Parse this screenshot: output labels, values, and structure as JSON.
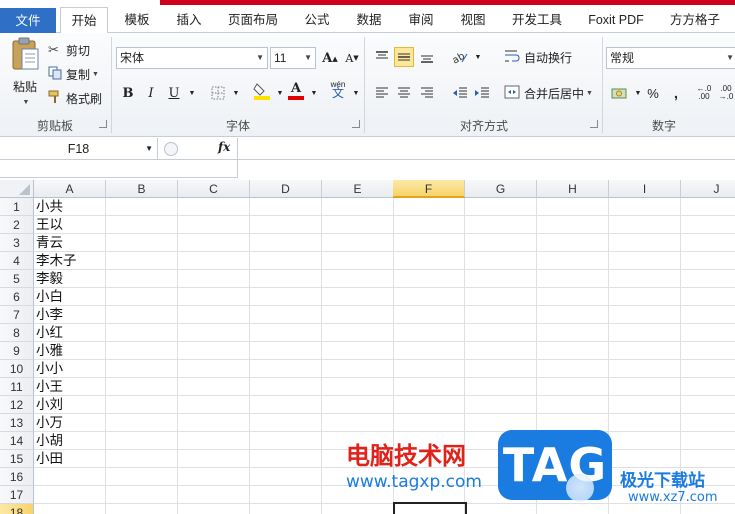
{
  "ribbon_tabs": [
    "文件",
    "开始",
    "模板",
    "插入",
    "页面布局",
    "公式",
    "数据",
    "审阅",
    "视图",
    "开发工具",
    "Foxit PDF",
    "方方格子"
  ],
  "active_tab": "开始",
  "clipboard": {
    "paste_label": "粘贴",
    "cut_label": "剪切",
    "copy_label": "复制",
    "format_painter_label": "格式刷",
    "group_label": "剪贴板"
  },
  "font": {
    "font_name": "宋体",
    "font_size": "11",
    "bold": "B",
    "italic": "I",
    "underline": "U",
    "font_color_letter": "A",
    "phonetic_label": "wén",
    "group_label": "字体"
  },
  "alignment": {
    "wrap_text_label": "自动换行",
    "merge_center_label": "合并后居中",
    "group_label": "对齐方式"
  },
  "number": {
    "format_value": "常规",
    "percent": "%",
    "comma": ",",
    "group_label": "数字"
  },
  "formula_bar": {
    "name_box": "F18",
    "fx_label": "fx"
  },
  "columns": [
    "A",
    "B",
    "C",
    "D",
    "E",
    "F",
    "G",
    "H",
    "I",
    "J"
  ],
  "selected_column": "F",
  "rows": [
    "1",
    "2",
    "3",
    "4",
    "5",
    "6",
    "7",
    "8",
    "9",
    "10",
    "11",
    "12",
    "13",
    "14",
    "15",
    "16",
    "17",
    "18"
  ],
  "selected_row": "18",
  "column_a_values": [
    "小共",
    "王以",
    "青云",
    "李木子",
    "李毅",
    "小白",
    "小李",
    "小红",
    "小雅",
    "小小",
    "小王",
    "小刘",
    "小万",
    "小胡",
    "小田"
  ],
  "watermark": {
    "site_name": "电脑技术网",
    "site_url": "www.tagxp.com",
    "logo_text": "TAG",
    "right_name": "极光下载站",
    "right_url": "www.xz7.com"
  },
  "colors": {
    "file_tab": "#2f6fc5",
    "top_bar": "#d0021b",
    "selection_header": "#f7d36a",
    "watermark_red": "#e0221a",
    "watermark_blue": "#1a7be0"
  }
}
